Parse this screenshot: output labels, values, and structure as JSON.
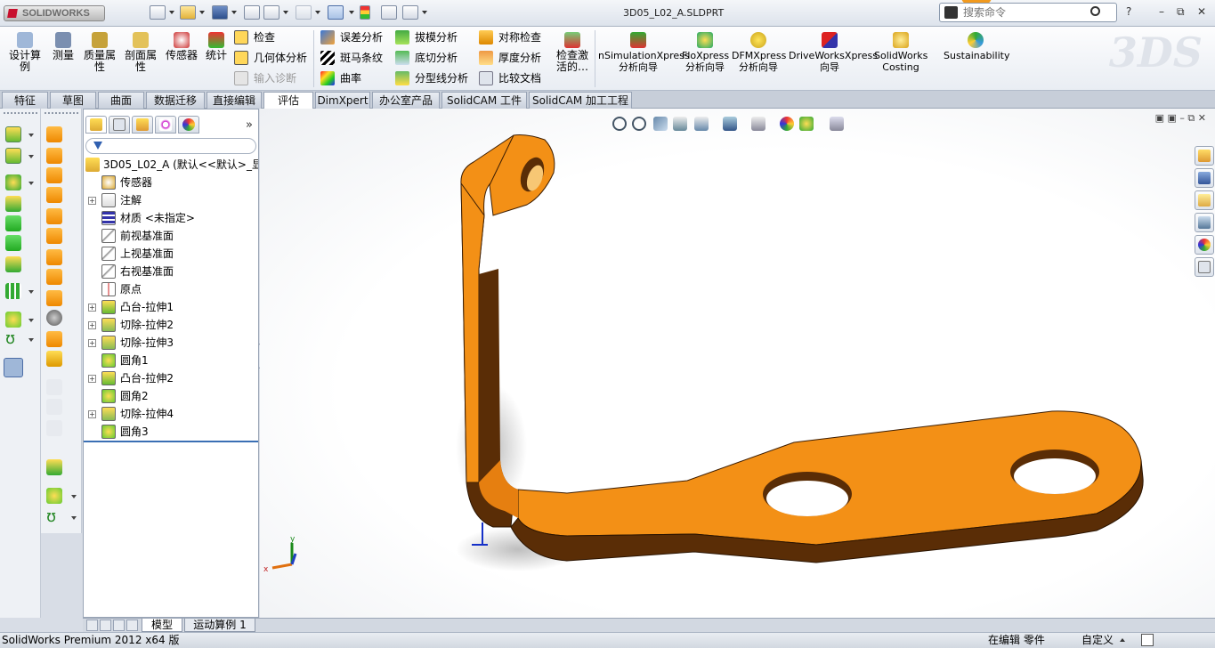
{
  "app": {
    "logo_text": "SOLIDWORKS",
    "doc_title": "3D05_L02_A.SLDPRT",
    "search_placeholder": "搜索命令",
    "window_controls": [
      "?",
      "–",
      "⧉",
      "✕"
    ]
  },
  "ribbon": {
    "big_buttons": [
      {
        "label": "设计算例",
        "icon": "design-study-icon"
      },
      {
        "label": "测量",
        "icon": "measure-icon"
      },
      {
        "label": "质量属性",
        "icon": "mass-properties-icon"
      },
      {
        "label": "剖面属性",
        "icon": "section-properties-icon"
      },
      {
        "label": "传感器",
        "icon": "sensor-icon"
      },
      {
        "label": "统计",
        "icon": "statistics-icon"
      }
    ],
    "small_col1": [
      "检查",
      "几何体分析",
      "输入诊断"
    ],
    "small_col2": [
      "误差分析",
      "斑马条纹",
      "曲率"
    ],
    "small_col3": [
      "拔模分析",
      "底切分析",
      "分型线分析"
    ],
    "small_col4": [
      "对称检查",
      "厚度分析",
      "比较文档"
    ],
    "check_active": "检查激活的…",
    "addins": [
      {
        "label": "nSimulationXpress 分析向导"
      },
      {
        "label": "FloXpress 分析向导"
      },
      {
        "label": "DFMXpress 分析向导"
      },
      {
        "label": "DriveWorksXpress 向导"
      },
      {
        "label": "SolidWorks Costing"
      },
      {
        "label": "Sustainability"
      }
    ]
  },
  "tabs": [
    "特征",
    "草图",
    "曲面",
    "数据迁移",
    "直接编辑",
    "评估",
    "DimXpert",
    "办公室产品",
    "SolidCAM 工件",
    "SolidCAM 加工工程"
  ],
  "active_tab": "评估",
  "feature_tree": {
    "root": "3D05_L02_A (默认<<默认>_显",
    "items": [
      {
        "label": "传感器",
        "expandable": false,
        "icon": "sensor-icon"
      },
      {
        "label": "注解",
        "expandable": true,
        "icon": "annotation-icon"
      },
      {
        "label": "材质 <未指定>",
        "expandable": false,
        "icon": "material-icon"
      },
      {
        "label": "前视基准面",
        "expandable": false,
        "icon": "plane-icon"
      },
      {
        "label": "上视基准面",
        "expandable": false,
        "icon": "plane-icon"
      },
      {
        "label": "右视基准面",
        "expandable": false,
        "icon": "plane-icon"
      },
      {
        "label": "原点",
        "expandable": false,
        "icon": "origin-icon"
      },
      {
        "label": "凸台-拉伸1",
        "expandable": true,
        "icon": "boss-extrude-icon"
      },
      {
        "label": "切除-拉伸2",
        "expandable": true,
        "icon": "cut-extrude-icon"
      },
      {
        "label": "切除-拉伸3",
        "expandable": true,
        "icon": "cut-extrude-icon"
      },
      {
        "label": "圆角1",
        "expandable": false,
        "icon": "fillet-icon"
      },
      {
        "label": "凸台-拉伸2",
        "expandable": true,
        "icon": "boss-extrude-icon"
      },
      {
        "label": "圆角2",
        "expandable": false,
        "icon": "fillet-icon"
      },
      {
        "label": "切除-拉伸4",
        "expandable": true,
        "icon": "cut-extrude-icon"
      },
      {
        "label": "圆角3",
        "expandable": false,
        "icon": "fillet-icon"
      }
    ]
  },
  "bottom_tabs": [
    "模型",
    "运动算例 1"
  ],
  "active_bottom_tab": "模型",
  "status": {
    "product": "SolidWorks Premium 2012 x64 版",
    "mode": "在编辑 零件",
    "units": "自定义"
  },
  "colors": {
    "part_orange": "#f39016",
    "part_dark": "#5a2d06",
    "ribbon_bg": "#eef1f5"
  }
}
